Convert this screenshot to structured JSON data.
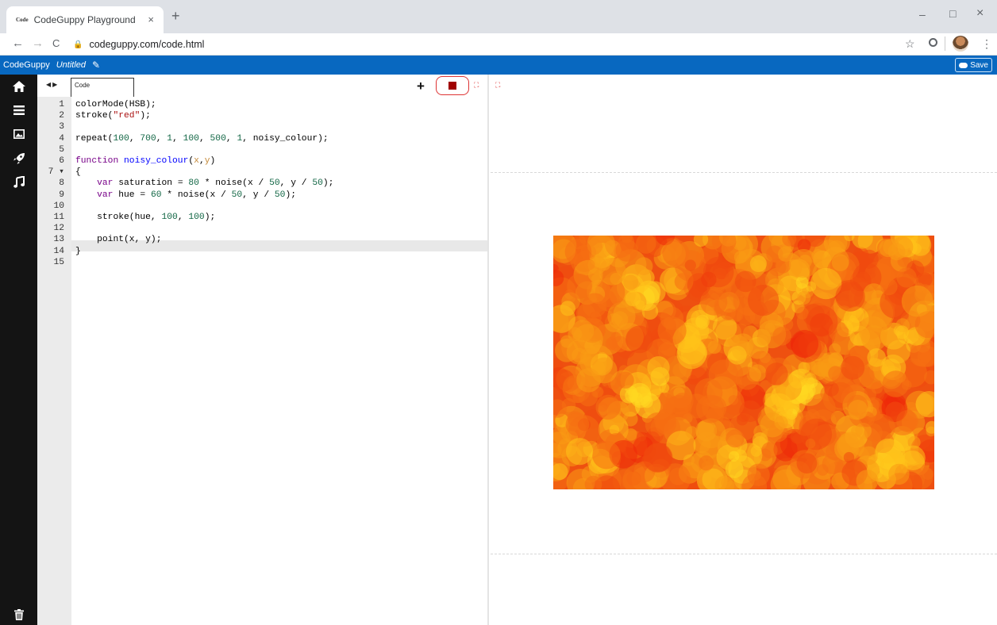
{
  "browser": {
    "tab_title": "CodeGuppy Playground",
    "tab_favicon_text": "Code",
    "tab_close": "×",
    "new_tab": "+",
    "url": "codeguppy.com/code.html",
    "back": "←",
    "forward": "→",
    "reload": "C",
    "star": "☆",
    "menu": "⋮",
    "minimize": "–",
    "maximize": "□",
    "close": "×"
  },
  "app": {
    "brand": "CodeGuppy",
    "doc_name": "Untitled",
    "save_label": "Save",
    "colors": {
      "header": "#0868c0",
      "sidebar": "#141414",
      "stop": "#a00000"
    }
  },
  "sidebar": {
    "items": [
      "home-icon",
      "menu-icon",
      "image-icon",
      "rocket-icon",
      "music-icon"
    ],
    "bottom": "trash-icon"
  },
  "editor": {
    "tab_label": "Code",
    "add_label": "+",
    "lines": [
      {
        "n": "1",
        "code": "colorMode(HSB);"
      },
      {
        "n": "2",
        "code": "stroke(\"red\");"
      },
      {
        "n": "3",
        "code": ""
      },
      {
        "n": "4",
        "code": "repeat(100, 700, 1, 100, 500, 1, noisy_colour);"
      },
      {
        "n": "5",
        "code": ""
      },
      {
        "n": "6",
        "code": "function noisy_colour(x,y)"
      },
      {
        "n": "7 ▾",
        "code": "{"
      },
      {
        "n": "8",
        "code": "    var saturation = 80 * noise(x / 50, y / 50);"
      },
      {
        "n": "9",
        "code": "    var hue = 60 * noise(x / 50, y / 50);"
      },
      {
        "n": "10",
        "code": ""
      },
      {
        "n": "11",
        "code": "    stroke(hue, 100, 100);"
      },
      {
        "n": "12",
        "code": ""
      },
      {
        "n": "13",
        "code": "    point(x, y);"
      },
      {
        "n": "14",
        "code": "}"
      },
      {
        "n": "15",
        "code": ""
      }
    ]
  },
  "output": {
    "canvas_colors": [
      "#ee2a0a",
      "#f04a0e",
      "#f57012",
      "#fa9a14",
      "#ffc21a",
      "#ffd820"
    ]
  }
}
